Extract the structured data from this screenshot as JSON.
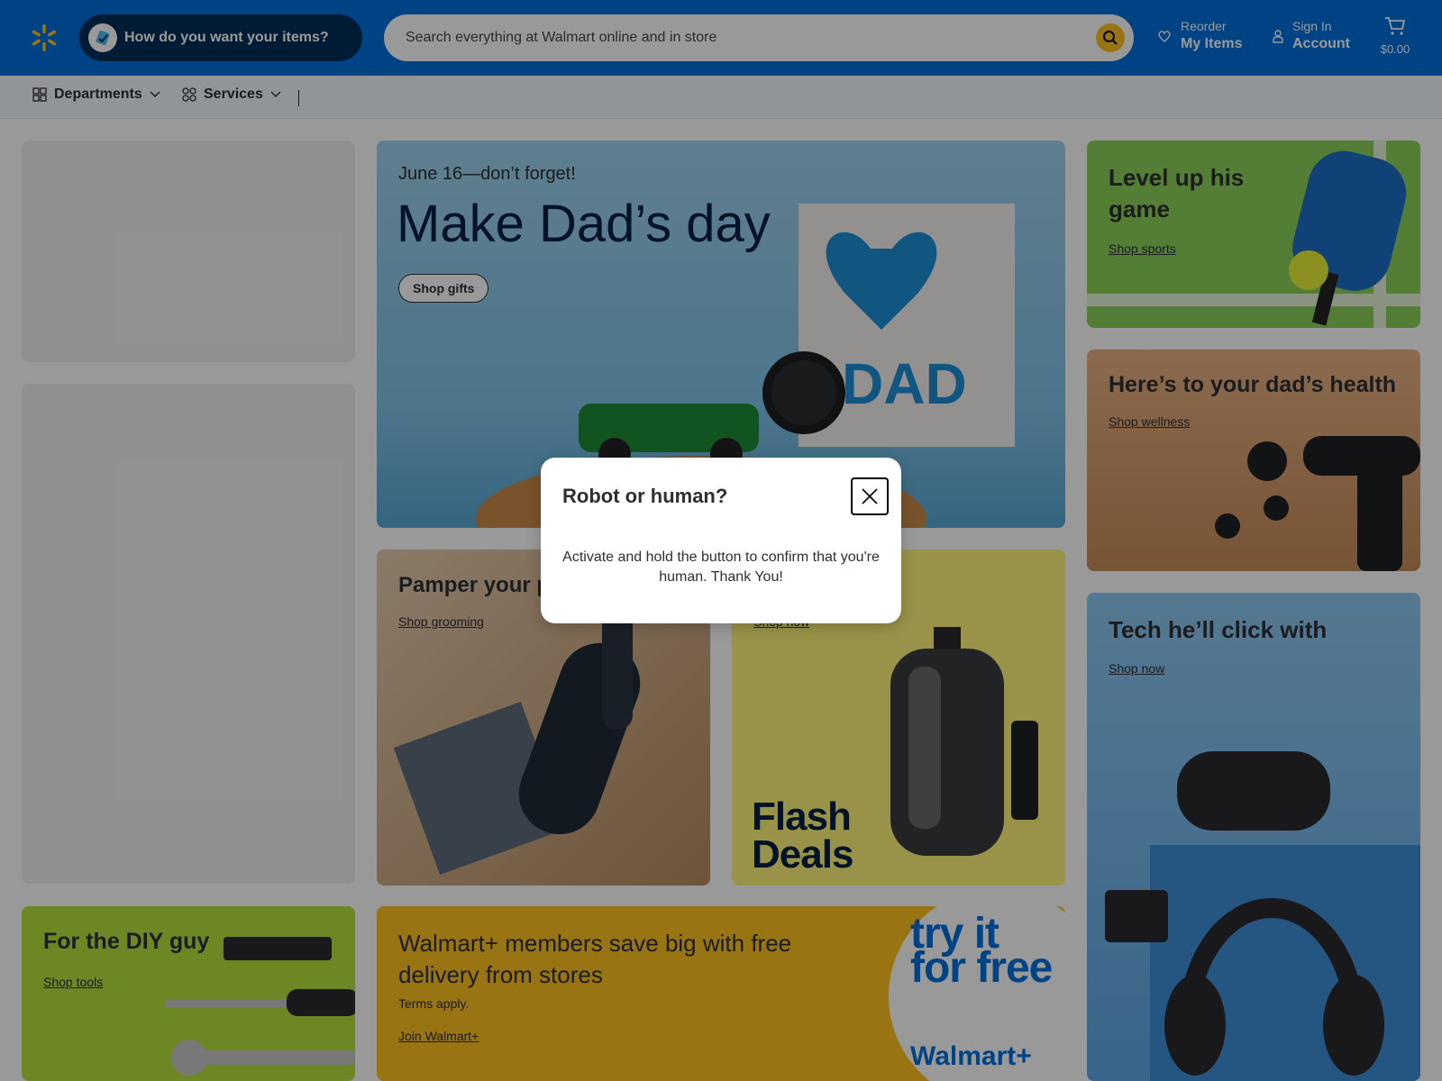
{
  "header": {
    "delivery_button": "How do you want your items?",
    "search_placeholder": "Search everything at Walmart online and in store",
    "reorder_small": "Reorder",
    "reorder_big": "My Items",
    "signin_small": "Sign In",
    "signin_big": "Account",
    "cart_total": "$0.00",
    "brand_blue": "#0071dc",
    "brand_yellow": "#ffc220"
  },
  "subnav": {
    "departments": "Departments",
    "services": "Services"
  },
  "hero": {
    "date": "June 16—don’t forget!",
    "title": "Make Dad’s day",
    "button": "Shop gifts"
  },
  "cards": {
    "sports": {
      "title": "Level up his game",
      "link": "Shop sports"
    },
    "health": {
      "title": "Here’s to your dad’s health",
      "link": "Shop wellness"
    },
    "tech": {
      "title": "Tech he’ll click with",
      "link": "Shop now"
    },
    "grooming": {
      "title": "Pamper your po",
      "link": "Shop grooming"
    },
    "flash": {
      "link": "Shop now",
      "text": "Flash Deals"
    },
    "diy": {
      "title": "For the DIY guy",
      "link": "Shop tools"
    },
    "walmart_plus": {
      "title": "Walmart+ members save big with free delivery from stores",
      "terms": "Terms apply.",
      "link": "Join Walmart+",
      "promo": "try it for free",
      "promo_brand": "Walmart+"
    }
  },
  "modal": {
    "title": "Robot or human?",
    "text": "Activate and hold the button to confirm that you're human. Thank You!"
  }
}
